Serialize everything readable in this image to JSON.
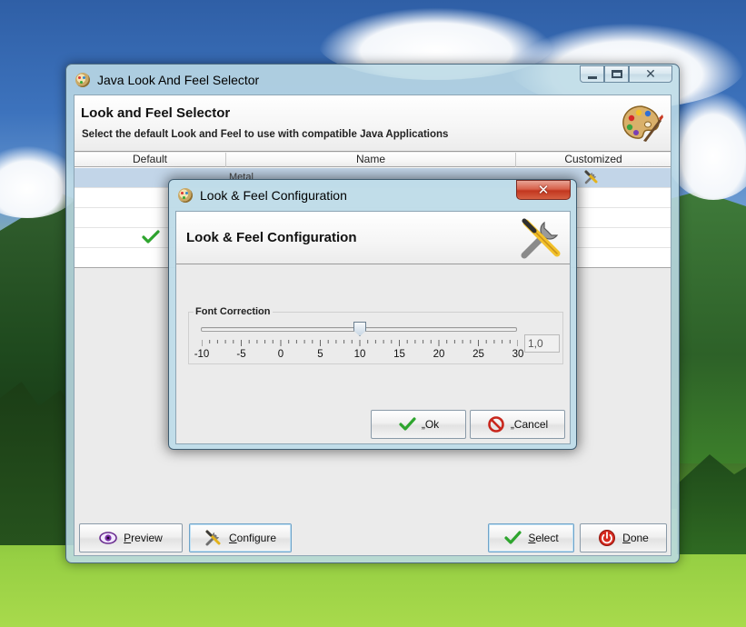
{
  "main_window": {
    "title": "Java Look And Feel Selector",
    "header": {
      "title": "Look and Feel Selector",
      "subtitle": "Select the default Look and Feel to use with compatible Java Applications"
    },
    "table": {
      "columns": [
        "Default",
        "Name",
        "Customized"
      ],
      "rows": [
        {
          "name": "Metal",
          "default": false,
          "customized": true,
          "selected": true
        },
        {
          "name": "",
          "default": false,
          "customized": false,
          "selected": false
        },
        {
          "name": "",
          "default": false,
          "customized": false,
          "selected": false
        },
        {
          "name": "",
          "default": true,
          "customized": false,
          "selected": false
        }
      ]
    },
    "buttons": {
      "preview": "Preview",
      "configure": "Configure",
      "select": "Select",
      "done": "Done"
    },
    "icons": {
      "app": "palette-icon",
      "header": "paint-palette-icon",
      "preview": "eye-icon",
      "configure": "tools-icon",
      "select": "checkmark-icon",
      "done": "power-icon"
    }
  },
  "dialog": {
    "title": "Look & Feel Configuration",
    "header_title": "Look & Feel Configuration",
    "group_title": "Font Correction",
    "slider": {
      "min": -10,
      "max": 30,
      "value": 10,
      "tick_labels": [
        "-10",
        "-5",
        "0",
        "5",
        "10",
        "15",
        "20",
        "25",
        "30"
      ]
    },
    "value_field": "1,0",
    "buttons": {
      "ok": "„Ok",
      "cancel": "„Cancel"
    }
  },
  "colors": {
    "selection_row": "#c2d5e8",
    "check_green": "#2ea52e",
    "close_red": "#c83a22"
  }
}
